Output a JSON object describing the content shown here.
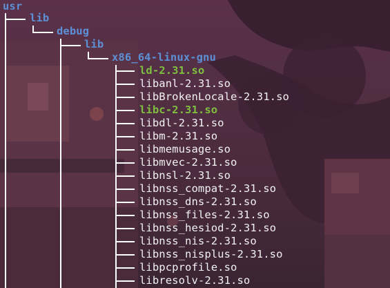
{
  "tree": {
    "root": "usr",
    "dirs": [
      "lib",
      "debug",
      "lib",
      "x86_64-linux-gnu"
    ],
    "files": [
      {
        "name": "ld-2.31.so",
        "kind": "exec"
      },
      {
        "name": "libanl-2.31.so",
        "kind": "file"
      },
      {
        "name": "libBrokenLocale-2.31.so",
        "kind": "file"
      },
      {
        "name": "libc-2.31.so",
        "kind": "exec"
      },
      {
        "name": "libdl-2.31.so",
        "kind": "file"
      },
      {
        "name": "libm-2.31.so",
        "kind": "file"
      },
      {
        "name": "libmemusage.so",
        "kind": "file"
      },
      {
        "name": "libmvec-2.31.so",
        "kind": "file"
      },
      {
        "name": "libnsl-2.31.so",
        "kind": "file"
      },
      {
        "name": "libnss_compat-2.31.so",
        "kind": "file"
      },
      {
        "name": "libnss_dns-2.31.so",
        "kind": "file"
      },
      {
        "name": "libnss_files-2.31.so",
        "kind": "file"
      },
      {
        "name": "libnss_hesiod-2.31.so",
        "kind": "file"
      },
      {
        "name": "libnss_nis-2.31.so",
        "kind": "file"
      },
      {
        "name": "libnss_nisplus-2.31.so",
        "kind": "file"
      },
      {
        "name": "libpcprofile.so",
        "kind": "file"
      },
      {
        "name": "libresolv-2.31.so",
        "kind": "file"
      }
    ]
  },
  "colors": {
    "directory": "#5d8fd6",
    "executable": "#7fbf3f",
    "file": "#f2f2f2",
    "connector": "#ffffff"
  }
}
